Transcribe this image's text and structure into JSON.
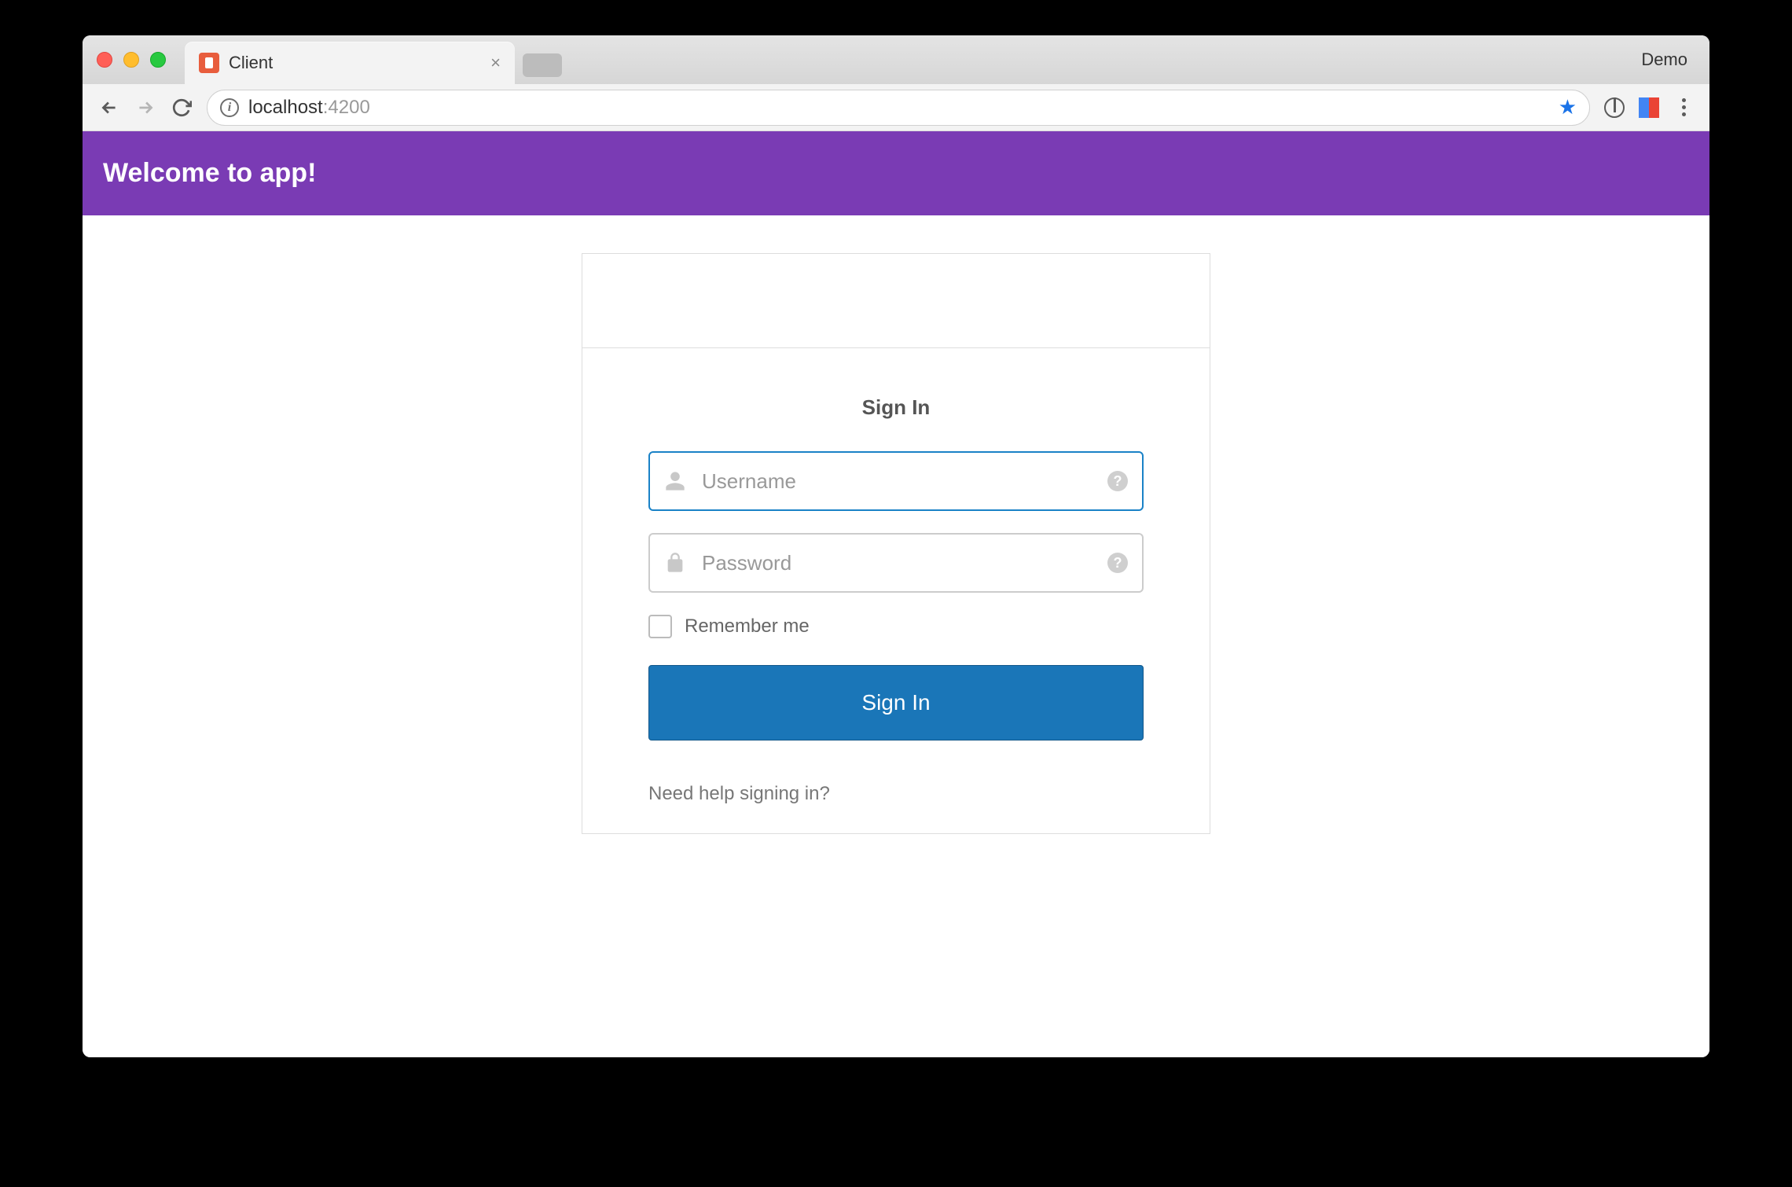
{
  "browser": {
    "tab_title": "Client",
    "right_label": "Demo",
    "url_host": "localhost",
    "url_port": ":4200"
  },
  "app": {
    "header_title": "Welcome to app!"
  },
  "signin": {
    "title": "Sign In",
    "username_placeholder": "Username",
    "username_value": "",
    "password_placeholder": "Password",
    "password_value": "",
    "remember_label": "Remember me",
    "submit_label": "Sign In",
    "help_link": "Need help signing in?"
  },
  "colors": {
    "brand": "#7a3bb4",
    "primary_button": "#1a76b8",
    "focus_border": "#1a82c7"
  }
}
